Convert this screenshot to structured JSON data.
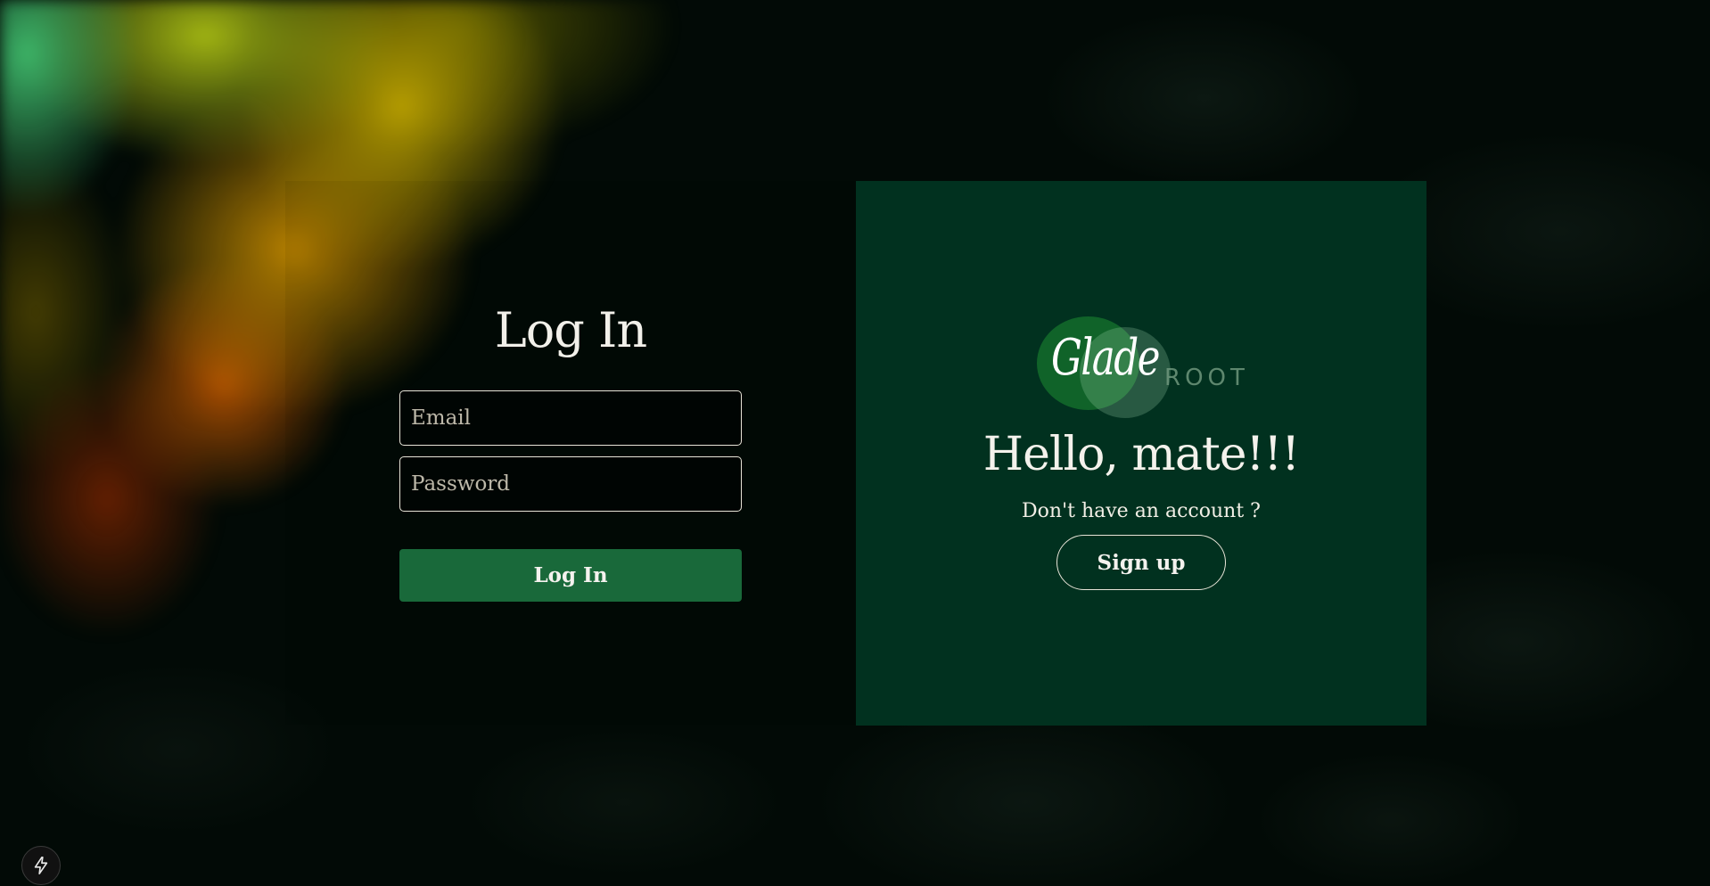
{
  "login": {
    "title": "Log In",
    "email_placeholder": "Email",
    "password_placeholder": "Password",
    "submit_label": "Log In"
  },
  "welcome": {
    "logo_script": "Glade",
    "logo_word": "ROOT",
    "greeting": "Hello, mate!!!",
    "prompt": "Don't have an account ?",
    "signup_label": "Sign up"
  },
  "corner": {
    "icon": "lightning-bolt-icon"
  },
  "colors": {
    "login_button": "#19693a",
    "right_panel": "#01311f",
    "background": "#020a06"
  }
}
